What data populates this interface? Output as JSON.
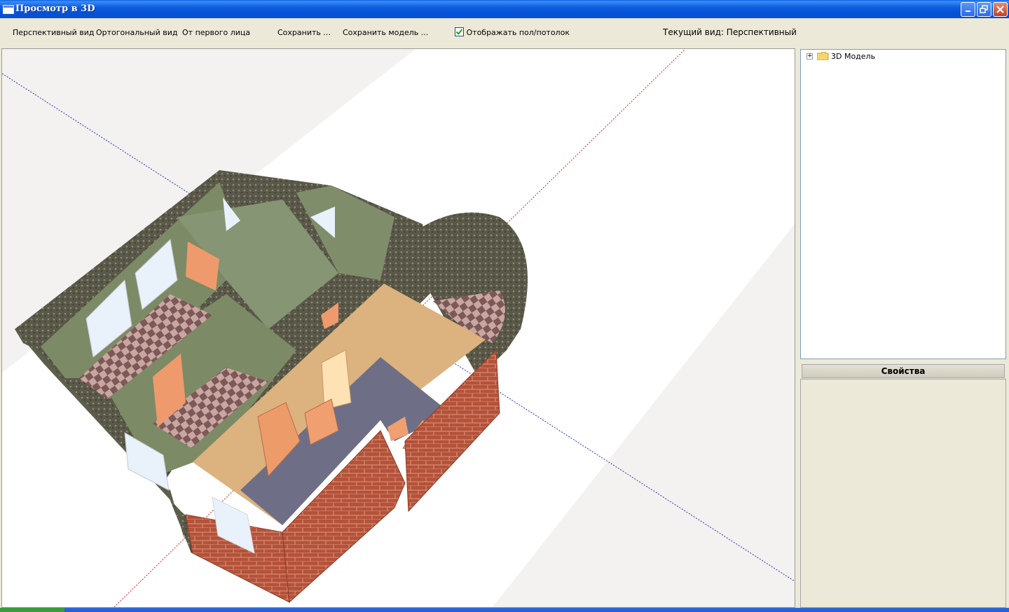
{
  "window": {
    "title": "Просмотр в 3D"
  },
  "toolbar": {
    "perspective_label": "Перспективный вид",
    "orthogonal_label": "Ортогональный вид",
    "first_person_label": "От первого лица",
    "save_label": "Сохранить ...",
    "save_model_label": "Сохранить модель ...",
    "show_floor_ceiling_label": "Отображать пол/потолок",
    "show_floor_ceiling_checked": true,
    "current_view_text": "Текущий вид: Перспективный"
  },
  "tree": {
    "root_label": "3D Модель",
    "expanded": false
  },
  "properties": {
    "header": "Свойства"
  },
  "colors": {
    "titlebar": "#0a5fe3",
    "viewport_bg": "#f3f2f0",
    "floor_plane": "#ffffff",
    "wall_outer": "#5e5e4c",
    "wall_inner": "#7c8a66",
    "brick": "#b4523a",
    "parquet": "#dcb27e",
    "carpet": "#6e6f86",
    "tiles": "#8d6a6a",
    "furniture": "#ee9b6a",
    "axis_x": "#e02020",
    "axis_y": "#1f2fbf"
  }
}
